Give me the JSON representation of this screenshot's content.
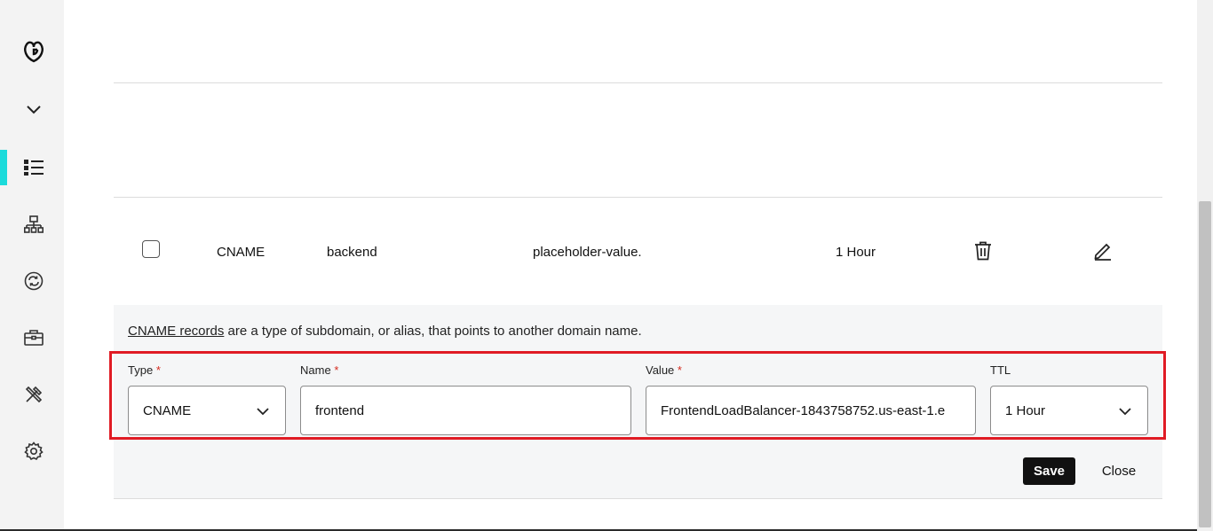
{
  "sidebar": {
    "items": [
      {
        "name": "godaddy-logo-icon"
      },
      {
        "name": "chevron-down-icon"
      },
      {
        "name": "list-icon",
        "active": true
      },
      {
        "name": "sitemap-icon"
      },
      {
        "name": "sync-icon"
      },
      {
        "name": "briefcase-icon"
      },
      {
        "name": "tools-icon"
      },
      {
        "name": "gear-icon"
      }
    ],
    "active_color": "#1bdbdb"
  },
  "record_row": {
    "type": "CNAME",
    "name": "backend",
    "value": "placeholder-value.",
    "ttl": "1 Hour",
    "delete_icon": "trash-icon",
    "edit_icon": "pencil-icon"
  },
  "editor": {
    "helper_link": "CNAME records",
    "helper_text": " are a type of subdomain, or alias, that points to another domain name.",
    "type_label": "Type",
    "name_label": "Name",
    "value_label": "Value",
    "ttl_label": "TTL",
    "required_mark": "*",
    "type_value": "CNAME",
    "name_value": "frontend",
    "value_value": "FrontendLoadBalancer-1843758752.us-east-1.e",
    "ttl_value": "1 Hour",
    "save_label": "Save",
    "close_label": "Close"
  },
  "colors": {
    "highlight_border": "#e01b24",
    "save_bg": "#111111",
    "required": "#d52b1e"
  }
}
